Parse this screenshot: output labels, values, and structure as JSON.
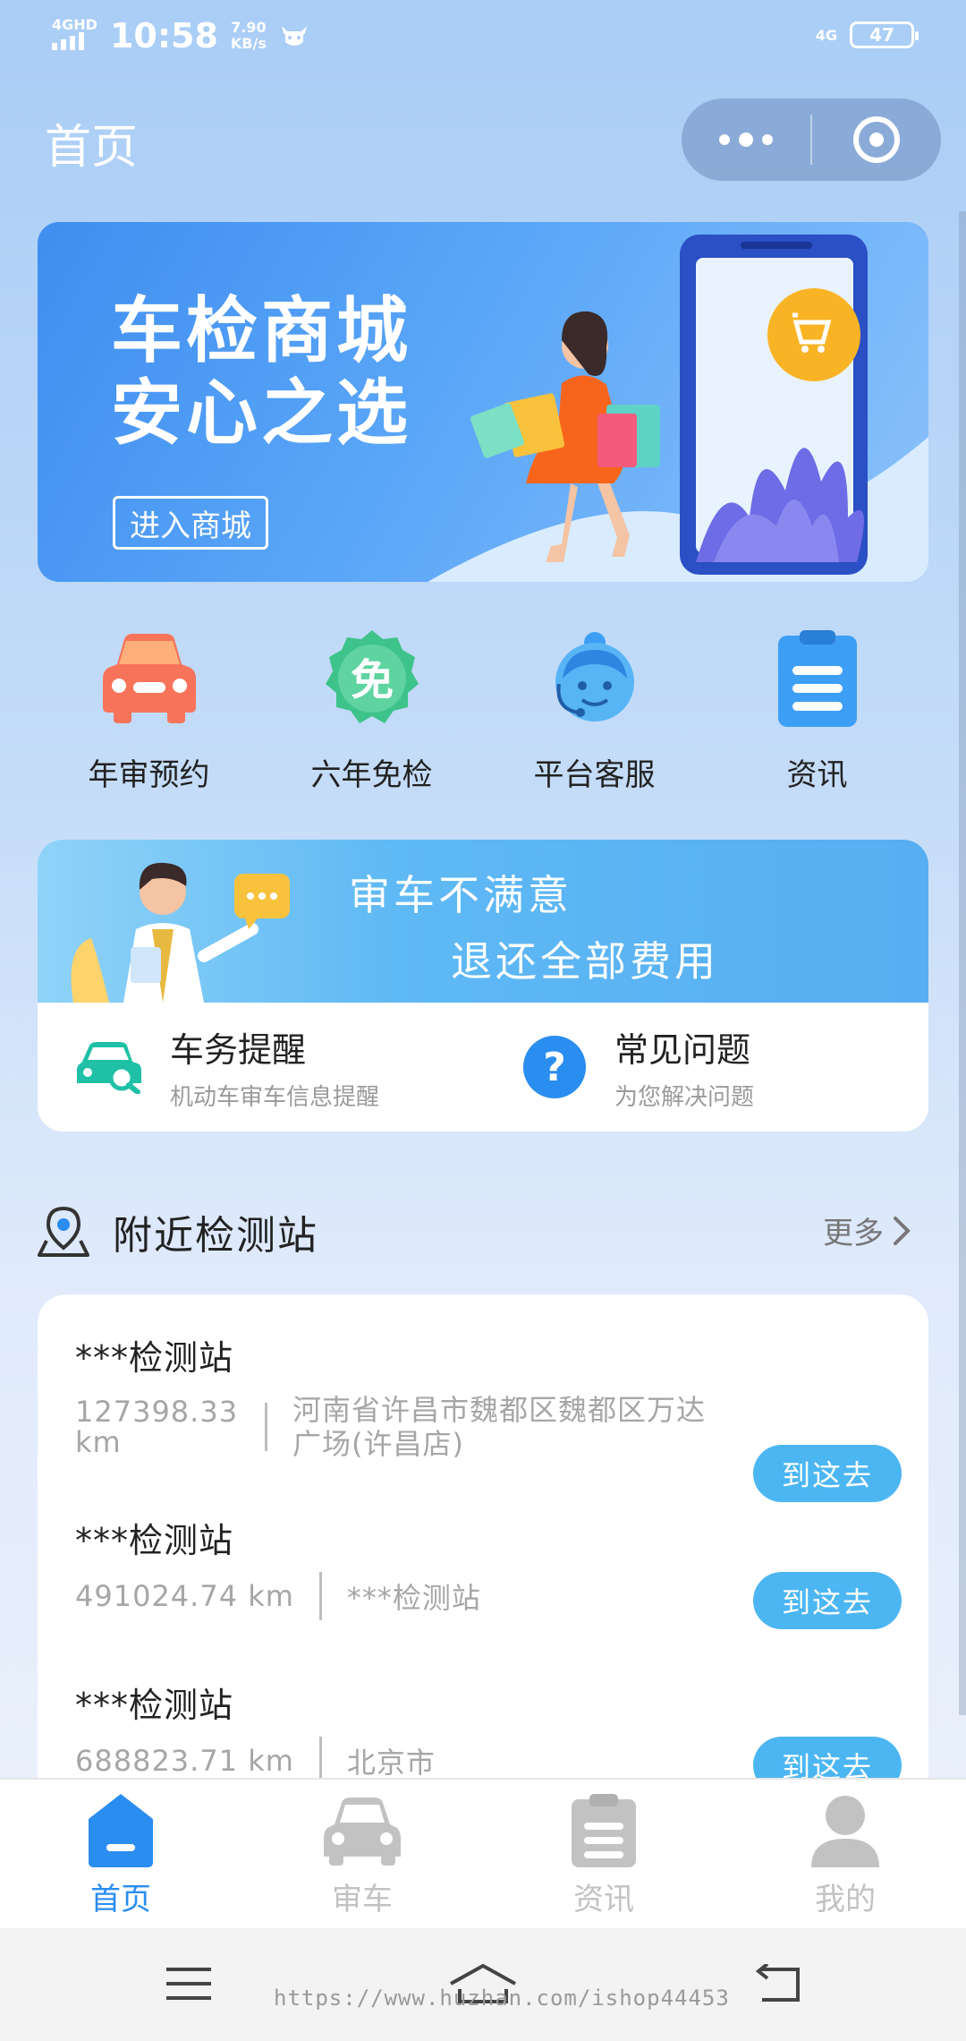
{
  "status_bar": {
    "network_left": "4GHD",
    "time": "10:58",
    "speed_value": "7.90",
    "speed_unit": "KB/s",
    "network_right": "4G",
    "battery": "47"
  },
  "header": {
    "title": "首页"
  },
  "banner": {
    "title_line1": "车检商城",
    "title_line2": "安心之选",
    "button_label": "进入商城"
  },
  "quick_actions": [
    {
      "label": "年审预约",
      "icon": "car-icon",
      "color": "#f7745a"
    },
    {
      "label": "六年免检",
      "icon": "exempt-badge-icon",
      "color": "#3ec38a"
    },
    {
      "label": "平台客服",
      "icon": "customer-service-icon",
      "color": "#58b5f5"
    },
    {
      "label": "资讯",
      "icon": "news-clipboard-icon",
      "color": "#3d9ef5"
    }
  ],
  "promo": {
    "line1": "审车不满意",
    "line2": "退还全部费用",
    "items": [
      {
        "title": "车务提醒",
        "subtitle": "机动车审车信息提醒",
        "icon": "car-search-icon"
      },
      {
        "title": "常见问题",
        "subtitle": "为您解决问题",
        "icon": "question-icon"
      }
    ]
  },
  "nearby": {
    "title": "附近检测站",
    "more_label": "更多",
    "go_label": "到这去",
    "stations": [
      {
        "name": "***检测站",
        "distance_line1": "127398.33",
        "distance_line2": "km",
        "address_line1": "河南省许昌市魏都区魏都区万达",
        "address_line2": "广场(许昌店)"
      },
      {
        "name": "***检测站",
        "distance": "491024.74 km",
        "address": "***检测站"
      },
      {
        "name": "***检测站",
        "distance": "688823.71 km",
        "address": "北京市"
      }
    ]
  },
  "tabbar": [
    {
      "label": "首页",
      "icon": "home-icon",
      "active": true
    },
    {
      "label": "审车",
      "icon": "car-icon",
      "active": false
    },
    {
      "label": "资讯",
      "icon": "news-icon",
      "active": false
    },
    {
      "label": "我的",
      "icon": "user-icon",
      "active": false
    }
  ],
  "watermark": "https://www.huzhan.com/ishop44453",
  "colors": {
    "accent": "#2a8df0",
    "go_button": "#4cb6f2"
  }
}
